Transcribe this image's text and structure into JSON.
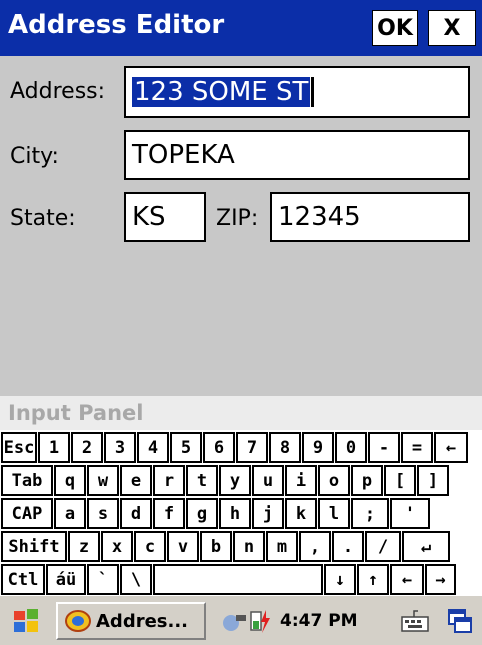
{
  "window": {
    "title": "Address Editor",
    "ok_label": "OK",
    "close_label": "X"
  },
  "form": {
    "address_label": "Address:",
    "address_value": "123 SOME ST",
    "city_label": "City:",
    "city_value": "TOPEKA",
    "state_label": "State:",
    "state_value": "KS",
    "zip_label": "ZIP:",
    "zip_value": "12345"
  },
  "input_panel": {
    "title": "Input Panel"
  },
  "keyboard": {
    "rows": [
      [
        "Esc",
        "1",
        "2",
        "3",
        "4",
        "5",
        "6",
        "7",
        "8",
        "9",
        "0",
        "-",
        "=",
        "←"
      ],
      [
        "Tab",
        "q",
        "w",
        "e",
        "r",
        "t",
        "y",
        "u",
        "i",
        "o",
        "p",
        "[",
        "]"
      ],
      [
        "CAP",
        "a",
        "s",
        "d",
        "f",
        "g",
        "h",
        "j",
        "k",
        "l",
        ";",
        "'"
      ],
      [
        "Shift",
        "z",
        "x",
        "c",
        "v",
        "b",
        "n",
        "m",
        ",",
        ".",
        "/",
        "↵"
      ],
      [
        "Ctl",
        "áü",
        "`",
        "\\",
        "",
        "↓",
        "↑",
        "←",
        "→"
      ]
    ]
  },
  "taskbar": {
    "task_label": "Addres...",
    "time": "4:47 PM"
  }
}
